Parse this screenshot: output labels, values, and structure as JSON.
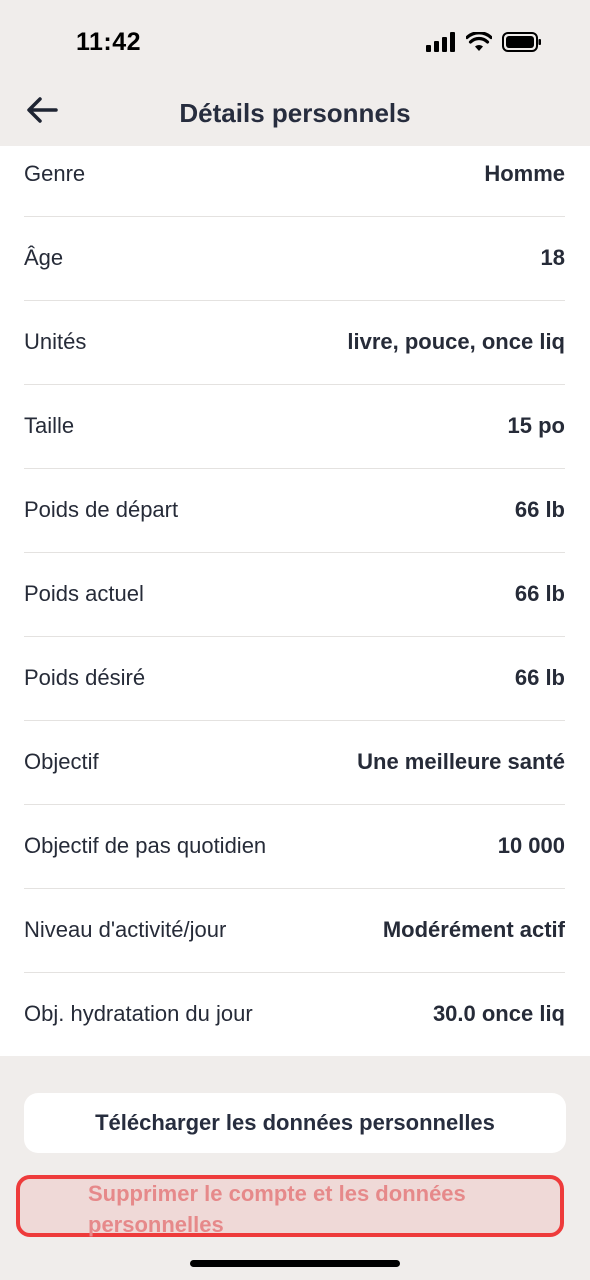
{
  "status_bar": {
    "time": "11:42"
  },
  "header": {
    "title": "Détails personnels"
  },
  "rows": [
    {
      "label": "Genre",
      "value": "Homme"
    },
    {
      "label": "Âge",
      "value": "18"
    },
    {
      "label": "Unités",
      "value": "livre, pouce, once liq"
    },
    {
      "label": "Taille",
      "value": "15 po"
    },
    {
      "label": "Poids de départ",
      "value": "66 lb"
    },
    {
      "label": "Poids actuel",
      "value": "66 lb"
    },
    {
      "label": "Poids désiré",
      "value": "66 lb"
    },
    {
      "label": "Objectif",
      "value": "Une meilleure santé"
    },
    {
      "label": "Objectif de pas quotidien",
      "value": "10 000"
    },
    {
      "label": "Niveau d'activité/jour",
      "value": "Modérément actif"
    },
    {
      "label": "Obj. hydratation du jour",
      "value": "30.0 once liq"
    }
  ],
  "actions": {
    "download_label": "Télécharger les données personnelles",
    "delete_label": "Supprimer le compte et les données personnelles"
  }
}
